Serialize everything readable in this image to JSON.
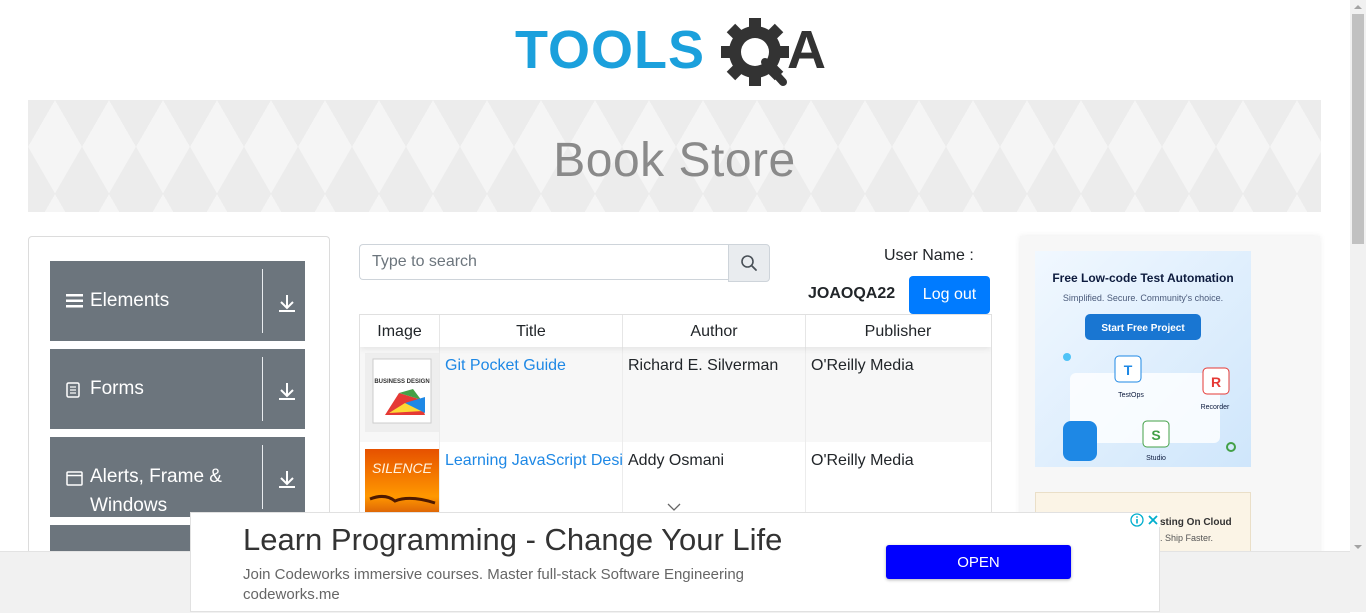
{
  "header": {
    "logo_text_left": "TOOLS",
    "logo_text_right": "A"
  },
  "banner": {
    "title": "Book Store"
  },
  "menu": {
    "groups": [
      {
        "label": "Elements",
        "icon": "hamburger-icon"
      },
      {
        "label": "Forms",
        "icon": "document-icon"
      },
      {
        "label": "Alerts, Frame & Windows",
        "icon": "window-icon"
      },
      {
        "label": "",
        "icon": ""
      }
    ]
  },
  "search": {
    "placeholder": "Type to search"
  },
  "user": {
    "label": "User Name :",
    "value": "JOAOQA22",
    "logout": "Log out"
  },
  "table": {
    "headers": [
      "Image",
      "Title",
      "Author",
      "Publisher"
    ],
    "rows": [
      {
        "title": "Git Pocket Guide",
        "author": "Richard E. Silverman",
        "publisher": "O'Reilly Media",
        "thumb_text": "BUSINESS DESIGN"
      },
      {
        "title": "Learning JavaScript Design Patterns",
        "author": "Addy Osmani",
        "publisher": "O'Reilly Media",
        "thumb_text": "SILENCE"
      }
    ]
  },
  "right_ad": {
    "title": "Free Low-code Test Automation",
    "subtitle": "Simplified. Secure. Community's choice.",
    "cta": "Start Free Project",
    "labels": [
      "TestOps",
      "Recorder",
      "Studio"
    ],
    "ad2_text": "sting On Cloud",
    "ad2_sub": ". Ship Faster."
  },
  "bottom_ad": {
    "headline": "Learn Programming - Change Your Life",
    "sub": "Join Codeworks immersive courses. Master full-stack Software Engineering",
    "url": "codeworks.me",
    "cta": "OPEN"
  },
  "colors": {
    "brand_blue": "#1ba0dc",
    "brand_dark": "#333333",
    "menu_bg": "#6c757d",
    "primary": "#007bff",
    "link": "#1e88e5",
    "ad_button": "#0000ff"
  }
}
